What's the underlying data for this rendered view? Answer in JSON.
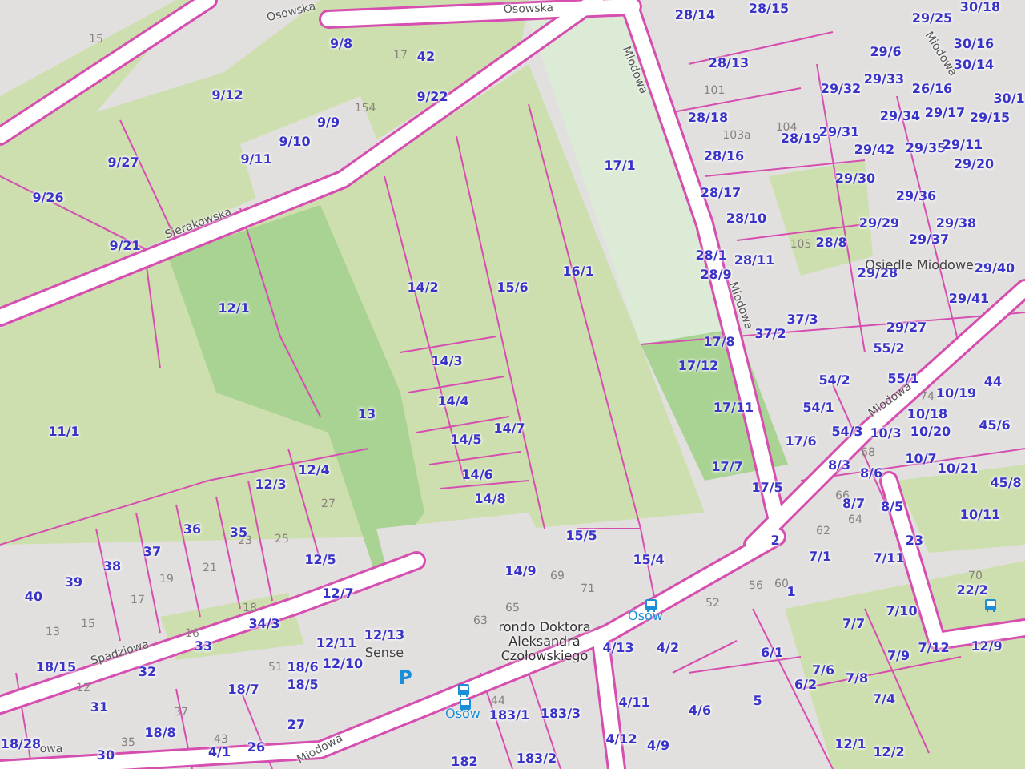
{
  "map": {
    "streets": [
      "Osowska",
      "Osowska",
      "Sierakowska",
      "Miodowa",
      "Miodowa",
      "Miodowa",
      "Miodowa",
      "Miodowa",
      "Spadziowa",
      "owa"
    ],
    "places": [
      {
        "name": "Osiedle Miodowe",
        "kind": "area"
      },
      {
        "name": "Sense",
        "kind": "poi"
      },
      {
        "name": "rondo Doktora Aleksandra Czołowskiego",
        "kind": "roundabout"
      }
    ],
    "bus_stops": [
      "Osów",
      "Osów"
    ],
    "parking_sign": "P",
    "parcels": [
      "28/14",
      "28/15",
      "29/25",
      "30/18",
      "9/8",
      "42",
      "29/6",
      "30/16",
      "28/13",
      "30/14",
      "29/32",
      "29/33",
      "26/16",
      "9/12",
      "9/22",
      "30/1",
      "9/9",
      "28/18",
      "29/34",
      "29/17",
      "29/15",
      "9/10",
      "28/19",
      "29/31",
      "29/42",
      "29/35",
      "29/11",
      "9/27",
      "9/11",
      "17/1",
      "28/16",
      "29/20",
      "29/30",
      "9/26",
      "28/17",
      "29/36",
      "28/10",
      "29/29",
      "29/38",
      "9/21",
      "28/8",
      "29/37",
      "28/1",
      "28/11",
      "16/1",
      "28/9",
      "29/28",
      "29/40",
      "14/2",
      "15/6",
      "29/41",
      "12/1",
      "37/2",
      "37/3",
      "29/27",
      "17/8",
      "55/2",
      "14/3",
      "17/12",
      "54/2",
      "55/1",
      "44",
      "13",
      "14/4",
      "17/11",
      "54/1",
      "10/19",
      "10/18",
      "11/1",
      "14/7",
      "54/3",
      "10/3",
      "10/20",
      "45/6",
      "14/5",
      "17/6",
      "12/4",
      "14/6",
      "17/7",
      "8/3",
      "8/6",
      "10/7",
      "10/21",
      "12/3",
      "17/5",
      "45/8",
      "14/8",
      "8/7",
      "8/5",
      "10/11",
      "36",
      "35",
      "15/5",
      "2",
      "23",
      "37",
      "12/5",
      "15/4",
      "7/1",
      "7/11",
      "38",
      "14/9",
      "40",
      "39",
      "12/7",
      "1",
      "22/2",
      "34/3",
      "7/7",
      "7/10",
      "33",
      "12/11",
      "12/13",
      "4/13",
      "4/2",
      "6/1",
      "7/9",
      "7/12",
      "12/9",
      "18/15",
      "32",
      "18/6",
      "12/10",
      "7/6",
      "7/8",
      "18/7",
      "18/5",
      "6/2",
      "4/11",
      "5",
      "7/4",
      "31",
      "183/1",
      "183/3",
      "4/6",
      "18/8",
      "27",
      "18/28",
      "30",
      "4/1",
      "26",
      "182",
      "183/2",
      "4/12",
      "4/9",
      "12/1",
      "12/2"
    ],
    "house_numbers": [
      "15",
      "17",
      "154",
      "101",
      "103a",
      "104",
      "105",
      "27",
      "25",
      "23",
      "21",
      "19",
      "17",
      "15",
      "13",
      "16",
      "18",
      "12",
      "51",
      "37",
      "35",
      "69",
      "71",
      "63",
      "65",
      "44",
      "56",
      "60",
      "62",
      "64",
      "66",
      "68",
      "74",
      "70",
      "52",
      "43"
    ]
  }
}
